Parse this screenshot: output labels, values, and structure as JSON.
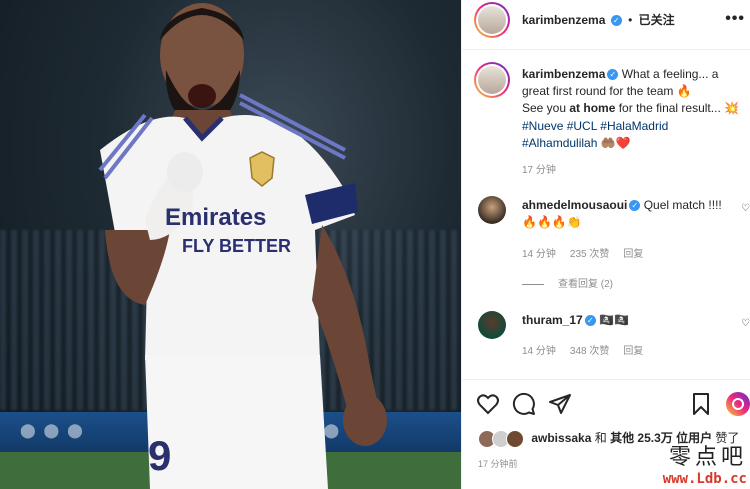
{
  "post": {
    "photo_label": "Karim Benzema celebrating in Real Madrid kit",
    "jersey_sponsor_line1": "Emirates",
    "jersey_sponsor_line2": "FLY BETTER",
    "jersey_number": "9"
  },
  "header": {
    "username": "karimbenzema",
    "verified_icon": "verified-badge-icon",
    "dot": "•",
    "follow_label": "已关注",
    "more_label": "•••"
  },
  "caption": {
    "username": "karimbenzema",
    "line1": "What a feeling... a great first round for the team 🔥",
    "line2_before": "See you ",
    "line2_bold": "at home",
    "line2_after": " for the final result... 💥",
    "hashtags": "#Nueve #UCL #HalaMadrid",
    "hashtag_last": "#Alhamdulilah",
    "emoji_tail": " 🤲🏽❤️",
    "time": "17 分钟"
  },
  "comments": [
    {
      "username": "ahmedelmousaoui",
      "text": "Quel match !!!!🔥🔥🔥👏",
      "time": "14 分钟",
      "likes": "235 次赞",
      "reply": "回复"
    },
    {
      "username": "thuram_17",
      "text": "🏴‍☠️🏴‍☠️",
      "time": "14 分钟",
      "likes": "348 次赞",
      "reply": "回复"
    }
  ],
  "view_replies": "查看回复 (2)",
  "likes_line": {
    "user": "awbissaka",
    "middle": " 和 ",
    "others": "其他 25.3万 位用户",
    "tail": " 赞了"
  },
  "posted_time": "17 分钟前",
  "watermark": {
    "cn": "零点吧",
    "url": "www.Ldb.cc"
  },
  "colors": {
    "link": "#00376b",
    "verified": "#3897f0",
    "meta": "#8e8e8e",
    "watermark_url": "#d63a2a"
  }
}
